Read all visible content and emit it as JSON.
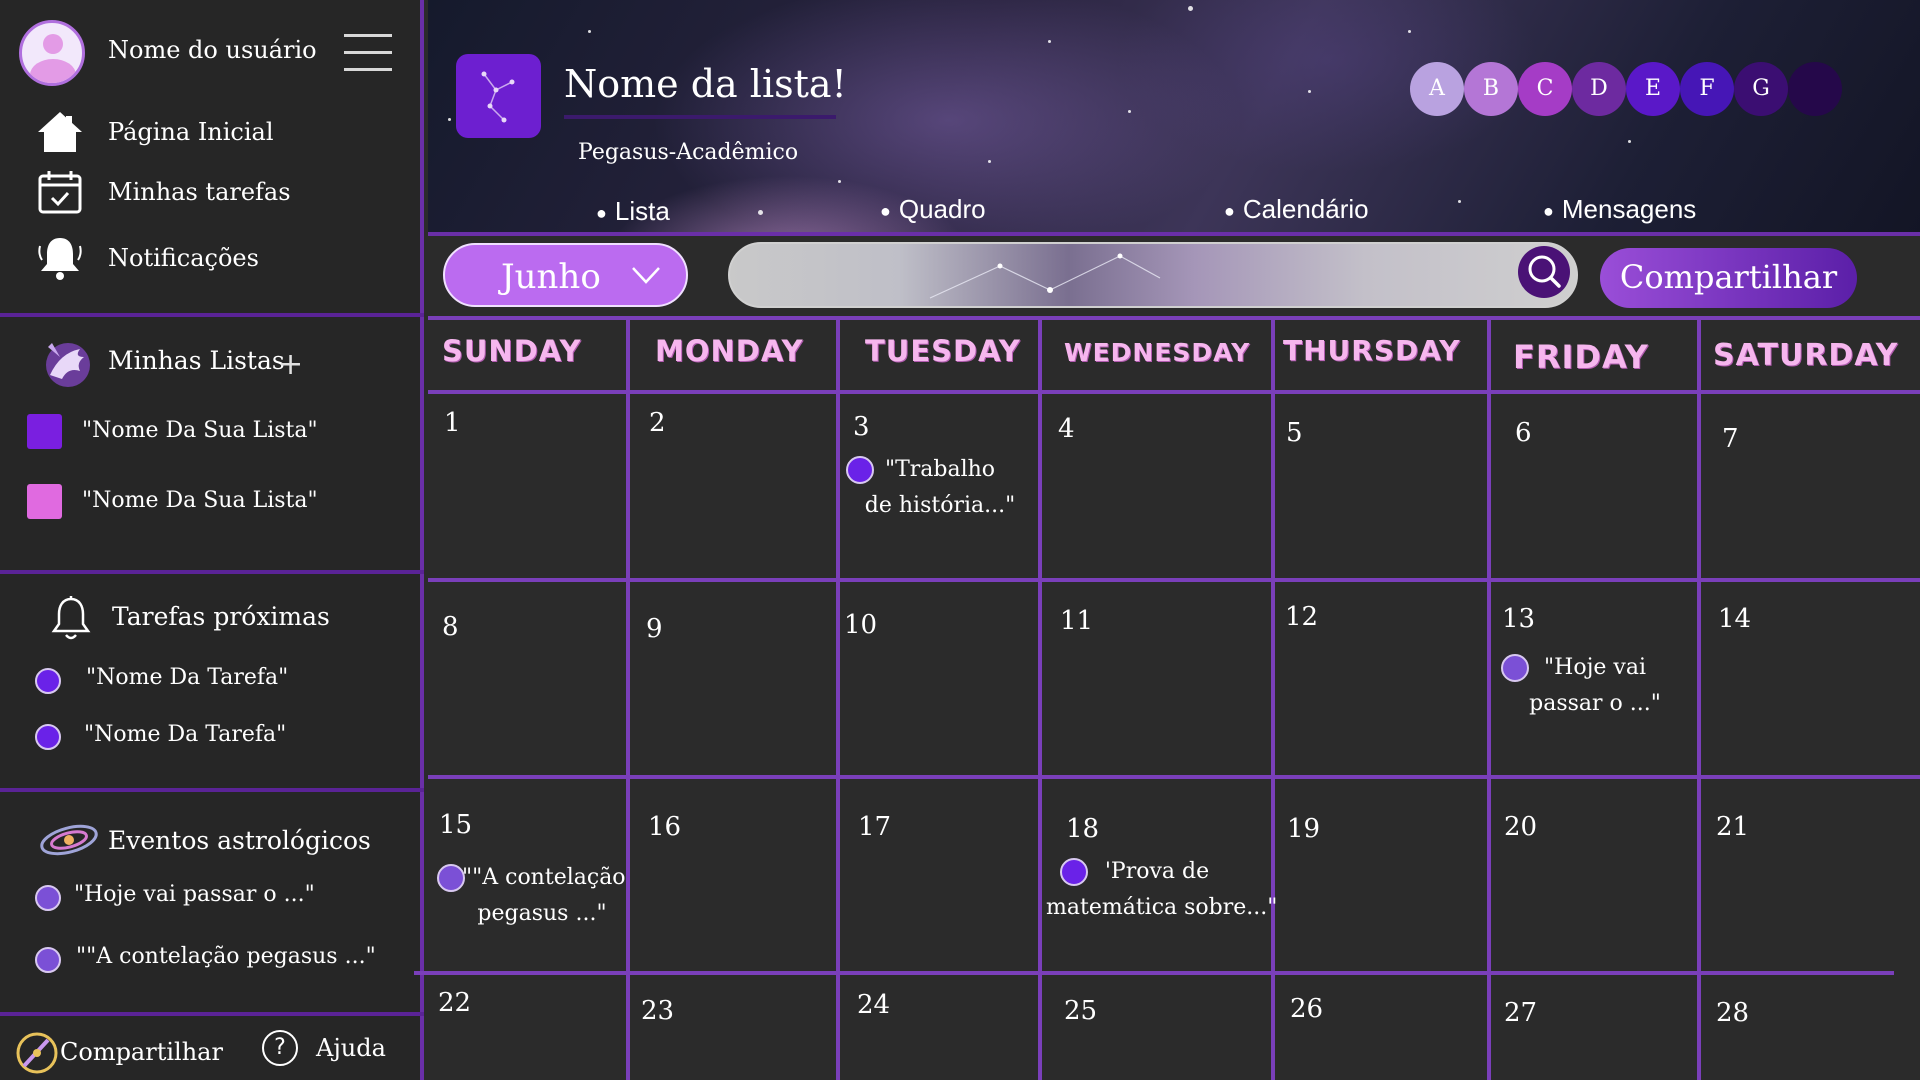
{
  "colors": {
    "accent": "#6a2fa8",
    "day_header": "#f6b6ee",
    "month_button": "#bb6bf0",
    "list_swatch_1": "#7a1fe0",
    "list_swatch_2": "#e06ae0",
    "task_dot": "#6a22e8",
    "event_dot": "#7b50d6"
  },
  "sidebar": {
    "user_name": "Nome do usuário",
    "nav": [
      {
        "label": "Página Inicial",
        "icon": "home-icon"
      },
      {
        "label": "Minhas tarefas",
        "icon": "calendar-check-icon"
      },
      {
        "label": "Notificações",
        "icon": "bell-icon"
      }
    ],
    "lists_title": "Minhas Listas",
    "lists_add": "+",
    "lists": [
      {
        "label": "\"Nome Da Sua Lista\""
      },
      {
        "label": "\"Nome Da Sua Lista\""
      }
    ],
    "upcoming_title": "Tarefas próximas",
    "upcoming": [
      {
        "label": "\"Nome Da Tarefa\""
      },
      {
        "label": "\"Nome Da Tarefa\""
      }
    ],
    "astro_title": "Eventos astrológicos",
    "astro": [
      {
        "label": "\"Hoje vai passar o ...\""
      },
      {
        "label": "\"\"A contelação pegasus ...\""
      }
    ],
    "footer": {
      "share_label": "Compartilhar",
      "help_symbol": "?",
      "help_label": "Ajuda"
    }
  },
  "header": {
    "list_title": "Nome da lista!",
    "subtitle": "Pegasus-Acadêmico",
    "members": [
      "A",
      "B",
      "C",
      "D",
      "E",
      "F",
      "G",
      ""
    ],
    "tabs": [
      "Lista",
      "Quadro",
      "Calendário",
      "Mensagens"
    ]
  },
  "toolbar": {
    "month": "Junho",
    "search_placeholder": "",
    "share_label": "Compartilhar"
  },
  "calendar": {
    "day_names": [
      "SUNDAY",
      "MONDAY",
      "TUESDAY",
      "WEDNESDAY",
      "THURSDAY",
      "FRIDAY",
      "SATURDAY"
    ],
    "days": [
      "1",
      "2",
      "3",
      "4",
      "5",
      "6",
      "7",
      "8",
      "9",
      "10",
      "11",
      "12",
      "13",
      "14",
      "15",
      "16",
      "17",
      "18",
      "19",
      "20",
      "21",
      "22",
      "23",
      "24",
      "25",
      "26",
      "27",
      "28"
    ],
    "events": [
      {
        "day": "3",
        "line1": "\"Trabalho",
        "line2": "de história...\""
      },
      {
        "day": "13",
        "line1": "\"Hoje vai",
        "line2": "passar o ...\""
      },
      {
        "day": "15",
        "line1": "\"\"A contelação",
        "line2": "pegasus ...\""
      },
      {
        "day": "18",
        "line1": "'Prova de",
        "line2": "matemática sobre...\""
      }
    ]
  }
}
